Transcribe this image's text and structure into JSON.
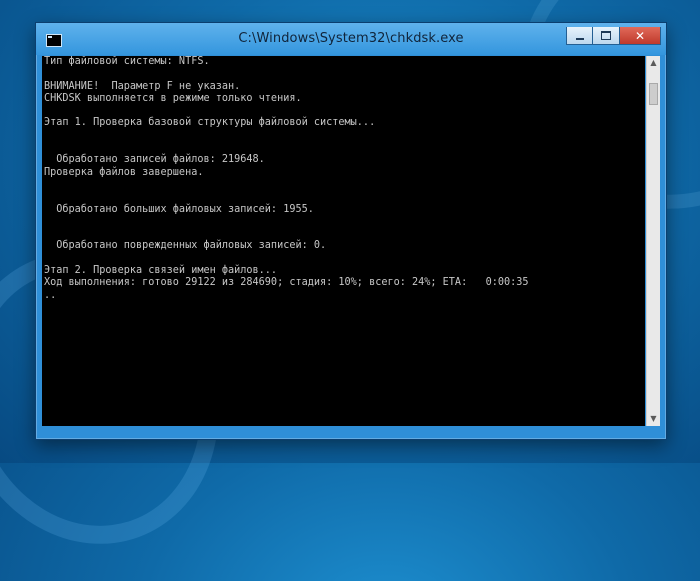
{
  "window": {
    "title": "C:\\Windows\\System32\\chkdsk.exe",
    "close_glyph": "✕"
  },
  "console": {
    "lines": [
      "Тип файловой системы: NTFS.",
      "",
      "ВНИМАНИЕ!  Параметр F не указан.",
      "CHKDSK выполняется в режиме только чтения.",
      "",
      "Этап 1. Проверка базовой структуры файловой системы...",
      "",
      "",
      "  Обработано записей файлов: 219648.",
      "Проверка файлов завершена.",
      "",
      "",
      "  Обработано больших файловых записей: 1955.",
      "",
      "",
      "  Обработано поврежденных файловых записей: 0.",
      "",
      "Этап 2. Проверка связей имен файлов...",
      "Ход выполнения: готово 29122 из 284690; стадия: 10%; всего: 24%; ETA:   0:00:35",
      ".."
    ]
  },
  "scrollbar": {
    "up_arrow": "▲",
    "down_arrow": "▼"
  },
  "icons": {
    "app": "console-app-icon",
    "minimize": "minimize-icon",
    "maximize": "maximize-icon",
    "close": "close-icon"
  }
}
